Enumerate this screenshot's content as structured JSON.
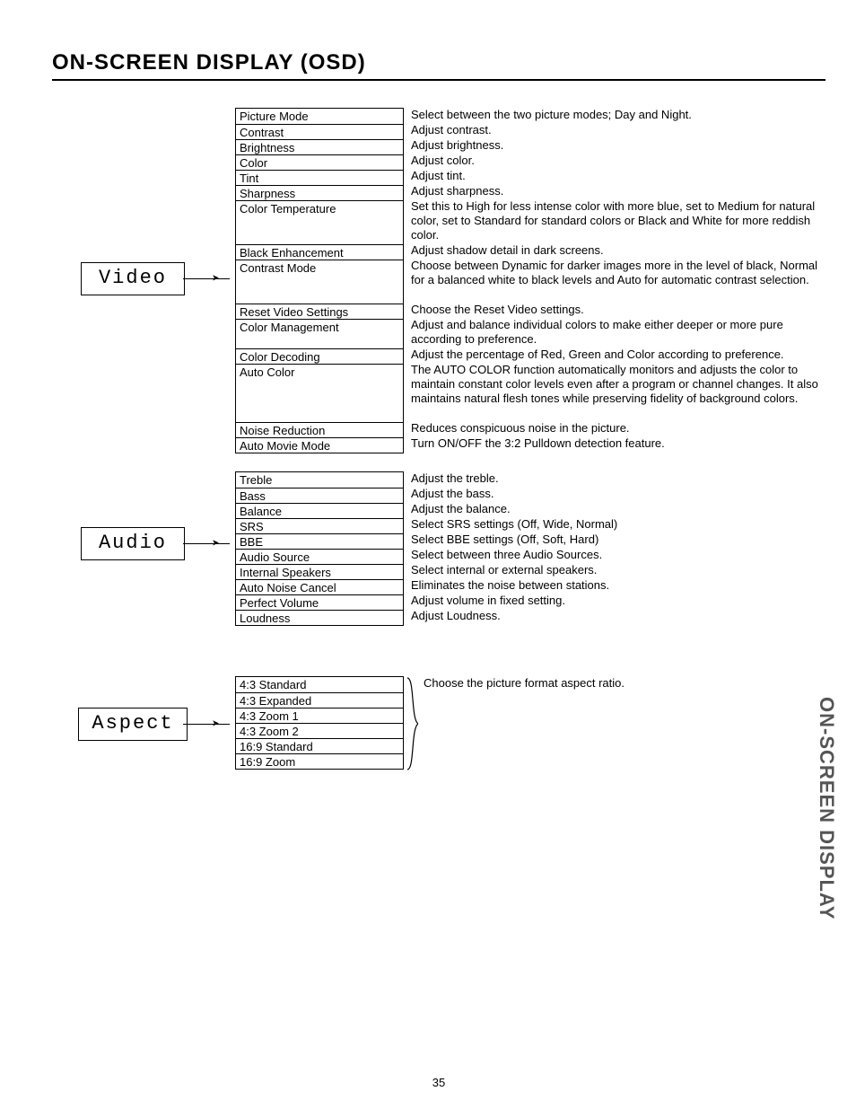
{
  "title": "ON-SCREEN DISPLAY (OSD)",
  "vertical_label": "ON-SCREEN DISPLAY",
  "page_number": "35",
  "sections": {
    "video": {
      "label": "Video",
      "items": [
        {
          "name": "Picture Mode",
          "desc": "Select between the two picture modes; Day and Night."
        },
        {
          "name": "Contrast",
          "desc": "Adjust contrast."
        },
        {
          "name": "Brightness",
          "desc": "Adjust brightness."
        },
        {
          "name": "Color",
          "desc": "Adjust color."
        },
        {
          "name": "Tint",
          "desc": "Adjust tint."
        },
        {
          "name": "Sharpness",
          "desc": "Adjust sharpness."
        },
        {
          "name": "Color Temperature",
          "desc": "Set this to High for less intense color with more blue, set to Medium for natural color, set to Standard for standard colors or Black and White for more reddish color.",
          "lines": 3
        },
        {
          "name": "Black Enhancement",
          "desc": "Adjust shadow detail in dark screens."
        },
        {
          "name": "Contrast Mode",
          "desc": "Choose between Dynamic for darker images more in the level of black, Normal for a balanced white to black levels and Auto for automatic contrast selection.",
          "lines": 3
        },
        {
          "name": "Reset Video Settings",
          "desc": "Choose the Reset Video settings."
        },
        {
          "name": "Color Management",
          "desc": "Adjust and balance individual colors to make either deeper or more pure according to preference.",
          "lines": 2
        },
        {
          "name": "Color Decoding",
          "desc": "Adjust the percentage of Red, Green and Color according to preference."
        },
        {
          "name": "Auto Color",
          "desc": "The AUTO COLOR function automatically monitors and adjusts the color to maintain constant color levels even after a program or channel changes. It also maintains natural flesh tones while preserving fidelity of background colors.",
          "lines": 4
        },
        {
          "name": "Noise Reduction",
          "desc": "Reduces conspicuous noise in the picture."
        },
        {
          "name": "Auto Movie Mode",
          "desc": "Turn ON/OFF the 3:2 Pulldown detection feature."
        }
      ]
    },
    "audio": {
      "label": "Audio",
      "items": [
        {
          "name": "Treble",
          "desc": "Adjust the treble."
        },
        {
          "name": "Bass",
          "desc": "Adjust the bass."
        },
        {
          "name": "Balance",
          "desc": "Adjust the balance."
        },
        {
          "name": "SRS",
          "desc": "Select SRS settings (Off, Wide, Normal)"
        },
        {
          "name": "BBE",
          "desc": "Select BBE settings (Off, Soft, Hard)"
        },
        {
          "name": "Audio Source",
          "desc": "Select between three Audio Sources."
        },
        {
          "name": "Internal Speakers",
          "desc": "Select internal or external speakers."
        },
        {
          "name": "Auto Noise Cancel",
          "desc": "Eliminates the noise between stations."
        },
        {
          "name": "Perfect Volume",
          "desc": "Adjust volume in fixed setting."
        },
        {
          "name": "Loudness",
          "desc": "Adjust Loudness."
        }
      ]
    },
    "aspect": {
      "label": "Aspect",
      "desc": "Choose the picture format aspect ratio.",
      "items": [
        {
          "name": "4:3 Standard"
        },
        {
          "name": "4:3 Expanded"
        },
        {
          "name": "4:3 Zoom 1"
        },
        {
          "name": "4:3 Zoom 2"
        },
        {
          "name": "16:9 Standard"
        },
        {
          "name": "16:9 Zoom"
        }
      ]
    }
  }
}
